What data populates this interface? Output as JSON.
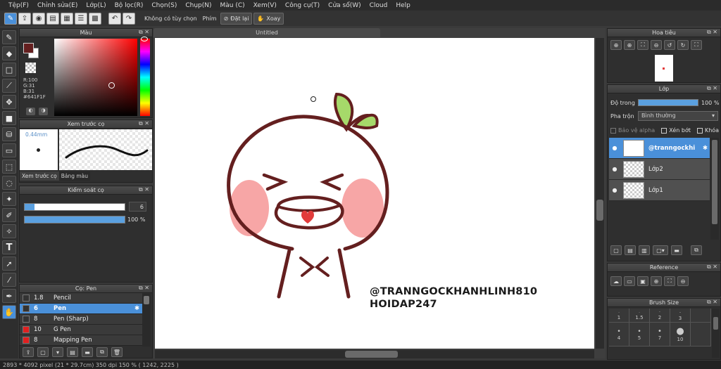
{
  "menu": [
    "Tệp(F)",
    "Chỉnh sửa(E)",
    "Lớp(L)",
    "Bộ lọc(R)",
    "Chọn(S)",
    "Chụp(N)",
    "Màu (C)",
    "Xem(V)",
    "Công cụ(T)",
    "Cửa sổ(W)",
    "Cloud",
    "Help"
  ],
  "toolbar": {
    "no_option": "Không có tùy chọn",
    "keys_label": "Phím",
    "reset_label": "Đặt lại",
    "rotate_label": "Xoay"
  },
  "color_panel": {
    "title": "Màu",
    "r": "R:100",
    "g": "G:31",
    "b": "B:31",
    "hex": "#641F1F",
    "fg_color": "#641F1F",
    "bg_color": "#ffffff"
  },
  "brush_preview": {
    "title": "Xem trước cọ",
    "size": "0.44mm",
    "tab1": "Xem trước cọ",
    "tab2": "Bảng màu"
  },
  "brush_control": {
    "title": "Kiểm soát cọ",
    "size_value": "6",
    "size_fraction": 0.1,
    "opacity_value": "100 %",
    "opacity_fraction": 1.0
  },
  "brush_list": {
    "title": "Cọ: Pen",
    "items": [
      {
        "size": "1.8",
        "name": "Pencil",
        "color": "#333333"
      },
      {
        "size": "6",
        "name": "Pen",
        "color": "#333333",
        "selected": true
      },
      {
        "size": "8",
        "name": "Pen (Sharp)",
        "color": "#333333"
      },
      {
        "size": "10",
        "name": "G Pen",
        "color": "#e02020"
      },
      {
        "size": "8",
        "name": "Mapping Pen",
        "color": "#e02020"
      }
    ]
  },
  "document": {
    "title": "Untitled",
    "watermark_line1": "@TRANNGOCKHANHLINH810",
    "watermark_line2": "HOIDAP247"
  },
  "navigator": {
    "title": "Hoa tiêu"
  },
  "layers": {
    "title": "Lớp",
    "opacity_label": "Độ trong",
    "opacity_value": "100 %",
    "blend_label": "Pha trộn",
    "blend_value": "Bình thường",
    "protect_alpha": "Bảo vệ alpha",
    "clipping": "Xén bớt",
    "lock": "Khóa",
    "items": [
      {
        "name": "@tranngockhi",
        "selected": true
      },
      {
        "name": "Lớp2",
        "selected": false
      },
      {
        "name": "Lớp1",
        "selected": false
      }
    ]
  },
  "reference": {
    "title": "Reference"
  },
  "brush_size": {
    "title": "Brush Size",
    "row1": [
      "1",
      "1.5",
      "2",
      "3",
      ""
    ],
    "row2": [
      "4",
      "5",
      "7",
      "10",
      ""
    ]
  },
  "status": "2893 * 4092 pixel   (21 * 29.7cm)   350 dpi   150 %   ( 1242, 2225 )"
}
